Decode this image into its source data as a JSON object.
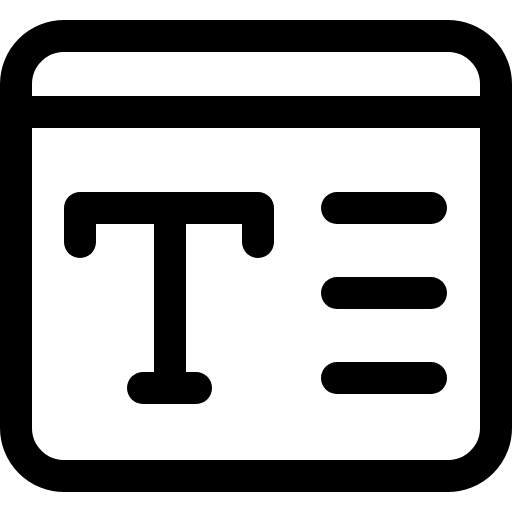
{
  "icon": {
    "name": "text-layout-window-icon",
    "stroke_color": "#000000",
    "background_color": "#ffffff"
  }
}
